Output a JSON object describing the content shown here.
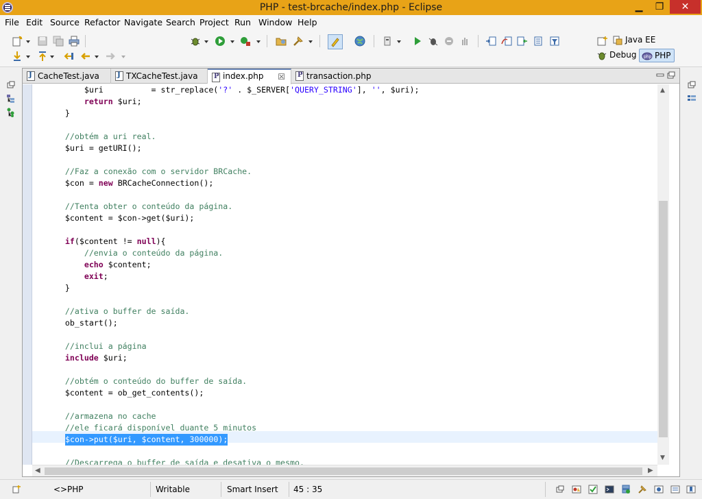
{
  "window": {
    "title": "PHP - test-brcache/index.php - Eclipse",
    "minimize": "▁",
    "maximize": "❐",
    "close": "✕"
  },
  "menu": {
    "items": [
      {
        "label": "File"
      },
      {
        "label": "Edit"
      },
      {
        "label": "Source"
      },
      {
        "label": "Refactor"
      },
      {
        "label": "Navigate"
      },
      {
        "label": "Search"
      },
      {
        "label": "Project"
      },
      {
        "label": "Run"
      },
      {
        "label": "Window"
      },
      {
        "label": "Help"
      }
    ]
  },
  "perspectives": [
    {
      "label": "Java EE",
      "active": false
    },
    {
      "label": "Debug",
      "active": false
    },
    {
      "label": "PHP",
      "active": true
    }
  ],
  "editor": {
    "tabs": [
      {
        "label": "CacheTest.java",
        "type": "java"
      },
      {
        "label": "TXCacheTest.java",
        "type": "java"
      },
      {
        "label": "index.php",
        "type": "php",
        "active": true
      },
      {
        "label": "transaction.php",
        "type": "php"
      }
    ],
    "tab_close": "☒",
    "lines": [
      "        $uri          = str_replace('?' . $_SERVER['QUERY_STRING'], '', $uri);",
      "        return $uri;",
      "    }",
      "",
      "    //obtém a uri real.",
      "    $uri = getURI();",
      "",
      "    //Faz a conexão com o servidor BRCache.",
      "    $con = new BRCacheConnection();",
      "",
      "    //Tenta obter o conteúdo da página.",
      "    $content = $con->get($uri);",
      "",
      "    if($content != null){",
      "        //envia o conteúdo da página.",
      "        echo $content;",
      "        exit;",
      "    }",
      "",
      "    //ativa o buffer de saída.",
      "    ob_start();",
      "",
      "    //inclui a página",
      "    include $uri;",
      "",
      "    //obtém o conteúdo do buffer de saída.",
      "    $content = ob_get_contents();",
      "",
      "    //armazena no cache",
      "    //ele ficará disponível duante 5 minutos",
      "    $con->put($uri, $content, 300000);",
      "",
      "    //Descarrega o buffer de saída e desativa o mesmo."
    ],
    "selected_line": 30
  },
  "status": {
    "outline": "PHP",
    "writable": "Writable",
    "insert_mode": "Smart Insert",
    "position": "45 : 35"
  },
  "colors": {
    "titlebar": "#e8a317",
    "selection": "#3399ff",
    "keyword": "#7f0055",
    "comment": "#3f7f5f",
    "string": "#2a00ff"
  }
}
